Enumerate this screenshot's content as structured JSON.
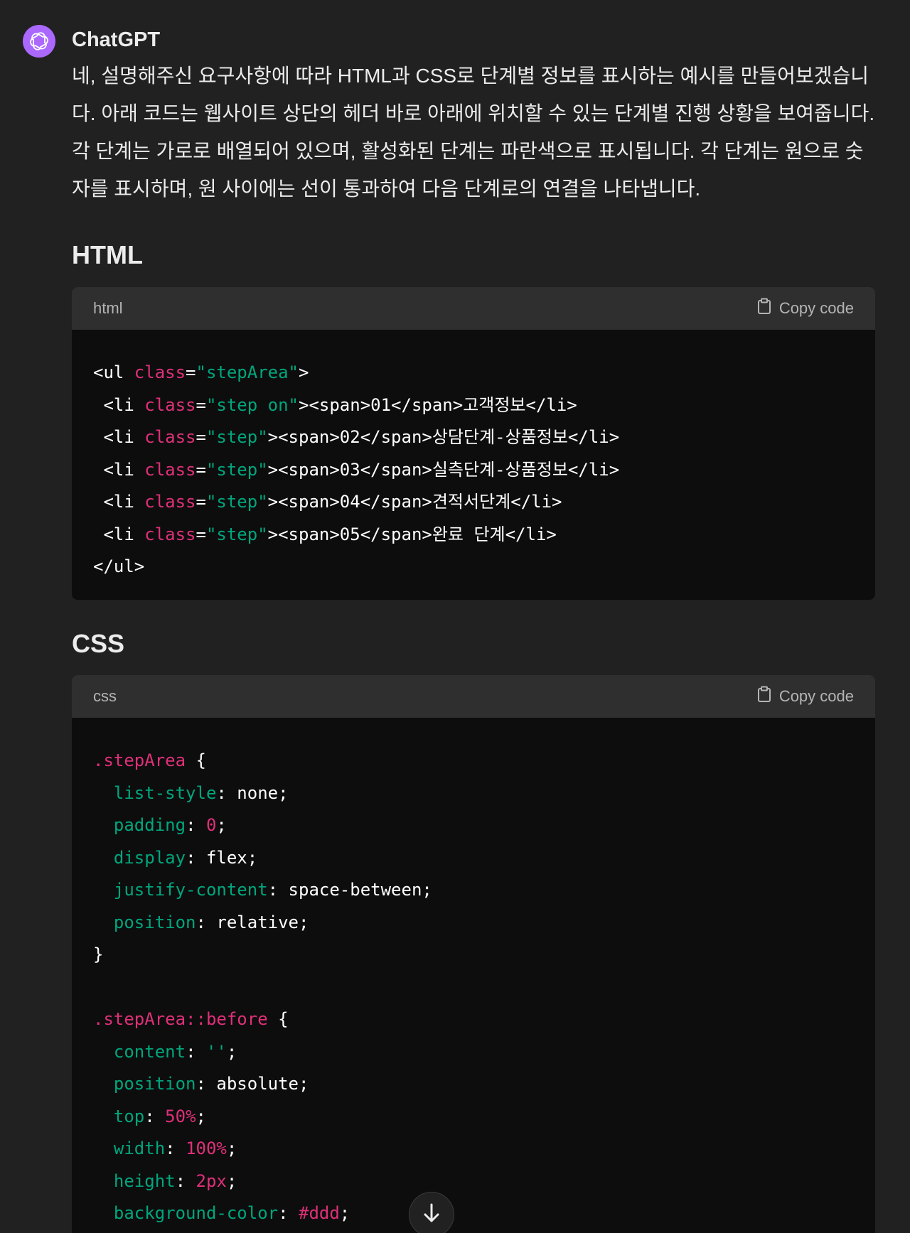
{
  "message": {
    "author": "ChatGPT",
    "intro_lines": [
      "네, 설명해주신 요구사항에 따라 HTML과 CSS로 단계별 정보를 표시하는 예시를 만들어보겠습니",
      "다. 아래 코드는 웹사이트 상단의 헤더 바로 아래에 위치할 수 있는 단계별 진행 상황을 보여줍니다.",
      "각 단계는 가로로 배열되어 있으며, 활성화된 단계는 파란색으로 표시됩니다. 각 단계는 원으로 숫",
      "자를 표시하며, 원 사이에는 선이 통과하여 다음 단계로의 연결을 나타냅니다."
    ]
  },
  "html_section": {
    "heading": "HTML",
    "language": "html",
    "copy_label": "Copy code",
    "lines": [
      [
        [
          "tag",
          "<ul "
        ],
        [
          "attr",
          "class"
        ],
        [
          "tag",
          "="
        ],
        [
          "str",
          "\"stepArea\""
        ],
        [
          "tag",
          ">"
        ]
      ],
      [
        [
          "tag",
          " <li "
        ],
        [
          "attr",
          "class"
        ],
        [
          "tag",
          "="
        ],
        [
          "str",
          "\"step on\""
        ],
        [
          "tag",
          "><span>01</span>고객정보</li>"
        ]
      ],
      [
        [
          "tag",
          " <li "
        ],
        [
          "attr",
          "class"
        ],
        [
          "tag",
          "="
        ],
        [
          "str",
          "\"step\""
        ],
        [
          "tag",
          "><span>02</span>상담단계-상품정보</li>"
        ]
      ],
      [
        [
          "tag",
          " <li "
        ],
        [
          "attr",
          "class"
        ],
        [
          "tag",
          "="
        ],
        [
          "str",
          "\"step\""
        ],
        [
          "tag",
          "><span>03</span>실측단계-상품정보</li>"
        ]
      ],
      [
        [
          "tag",
          " <li "
        ],
        [
          "attr",
          "class"
        ],
        [
          "tag",
          "="
        ],
        [
          "str",
          "\"step\""
        ],
        [
          "tag",
          "><span>04</span>견적서단계</li>"
        ]
      ],
      [
        [
          "tag",
          " <li "
        ],
        [
          "attr",
          "class"
        ],
        [
          "tag",
          "="
        ],
        [
          "str",
          "\"step\""
        ],
        [
          "tag",
          "><span>05</span>완료 단계</li>"
        ]
      ],
      [
        [
          "tag",
          "</ul>"
        ]
      ]
    ]
  },
  "css_section": {
    "heading": "CSS",
    "language": "css",
    "copy_label": "Copy code",
    "lines": [
      [
        [
          "sel",
          ".stepArea"
        ],
        [
          "plain",
          " {"
        ]
      ],
      [
        [
          "plain",
          "  "
        ],
        [
          "prop",
          "list-style"
        ],
        [
          "plain",
          ": none;"
        ]
      ],
      [
        [
          "plain",
          "  "
        ],
        [
          "prop",
          "padding"
        ],
        [
          "plain",
          ": "
        ],
        [
          "num",
          "0"
        ],
        [
          "plain",
          ";"
        ]
      ],
      [
        [
          "plain",
          "  "
        ],
        [
          "prop",
          "display"
        ],
        [
          "plain",
          ": flex;"
        ]
      ],
      [
        [
          "plain",
          "  "
        ],
        [
          "prop",
          "justify-content"
        ],
        [
          "plain",
          ": space-between;"
        ]
      ],
      [
        [
          "plain",
          "  "
        ],
        [
          "prop",
          "position"
        ],
        [
          "plain",
          ": relative;"
        ]
      ],
      [
        [
          "plain",
          "}"
        ]
      ],
      [
        [
          "plain",
          ""
        ]
      ],
      [
        [
          "sel",
          ".stepArea::before"
        ],
        [
          "plain",
          " {"
        ]
      ],
      [
        [
          "plain",
          "  "
        ],
        [
          "prop",
          "content"
        ],
        [
          "plain",
          ": "
        ],
        [
          "str",
          "''"
        ],
        [
          "plain",
          ";"
        ]
      ],
      [
        [
          "plain",
          "  "
        ],
        [
          "prop",
          "position"
        ],
        [
          "plain",
          ": absolute;"
        ]
      ],
      [
        [
          "plain",
          "  "
        ],
        [
          "prop",
          "top"
        ],
        [
          "plain",
          ": "
        ],
        [
          "num",
          "50%"
        ],
        [
          "plain",
          ";"
        ]
      ],
      [
        [
          "plain",
          "  "
        ],
        [
          "prop",
          "width"
        ],
        [
          "plain",
          ": "
        ],
        [
          "num",
          "100%"
        ],
        [
          "plain",
          ";"
        ]
      ],
      [
        [
          "plain",
          "  "
        ],
        [
          "prop",
          "height"
        ],
        [
          "plain",
          ": "
        ],
        [
          "num",
          "2px"
        ],
        [
          "plain",
          ";"
        ]
      ],
      [
        [
          "plain",
          "  "
        ],
        [
          "prop",
          "background-color"
        ],
        [
          "plain",
          ": "
        ],
        [
          "num",
          "#ddd"
        ],
        [
          "plain",
          ";"
        ]
      ]
    ]
  },
  "scroll_button": {
    "icon": "arrow-down-icon"
  },
  "colors": {
    "background": "#212121",
    "code_background": "#0d0d0d",
    "code_header": "#2f2f2f",
    "avatar": "#ab68ff",
    "token_pink": "#df3079",
    "token_green": "#00a67d"
  }
}
